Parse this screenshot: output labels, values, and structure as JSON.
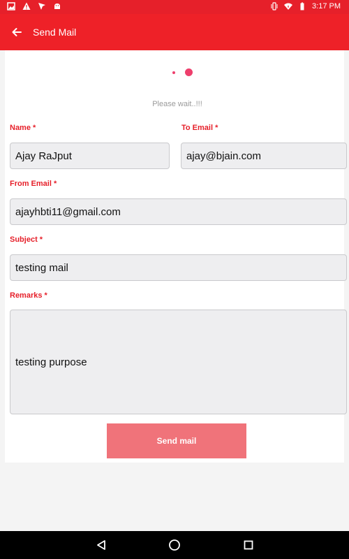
{
  "status_bar": {
    "time": "3:17 PM",
    "left_icons": [
      "image-icon",
      "warning-icon",
      "navigation-icon",
      "android-icon"
    ],
    "right_icons": [
      "vibrate-icon",
      "wifi-icon",
      "battery-icon"
    ]
  },
  "app_bar": {
    "title": "Send Mail",
    "back_icon": "arrow-left-icon",
    "color": "#ee2128"
  },
  "loading": {
    "text": "Please wait..!!!",
    "dot_color": "#ee3f6c"
  },
  "form": {
    "name": {
      "label": "Name *",
      "value": "Ajay RaJput"
    },
    "to_email": {
      "label": "To Email *",
      "value": "ajay@bjain.com"
    },
    "from_email": {
      "label": "From Email *",
      "value": "ajayhbti11@gmail.com"
    },
    "subject": {
      "label": "Subject *",
      "value": "testing mail"
    },
    "remarks": {
      "label": "Remarks *",
      "value": "testing purpose"
    },
    "label_color": "#e6202a"
  },
  "send_button": {
    "label": "Send mail",
    "color": "#f0737a"
  },
  "nav_bar": {
    "buttons": [
      "back-triangle-icon",
      "home-circle-icon",
      "recents-square-icon"
    ]
  }
}
